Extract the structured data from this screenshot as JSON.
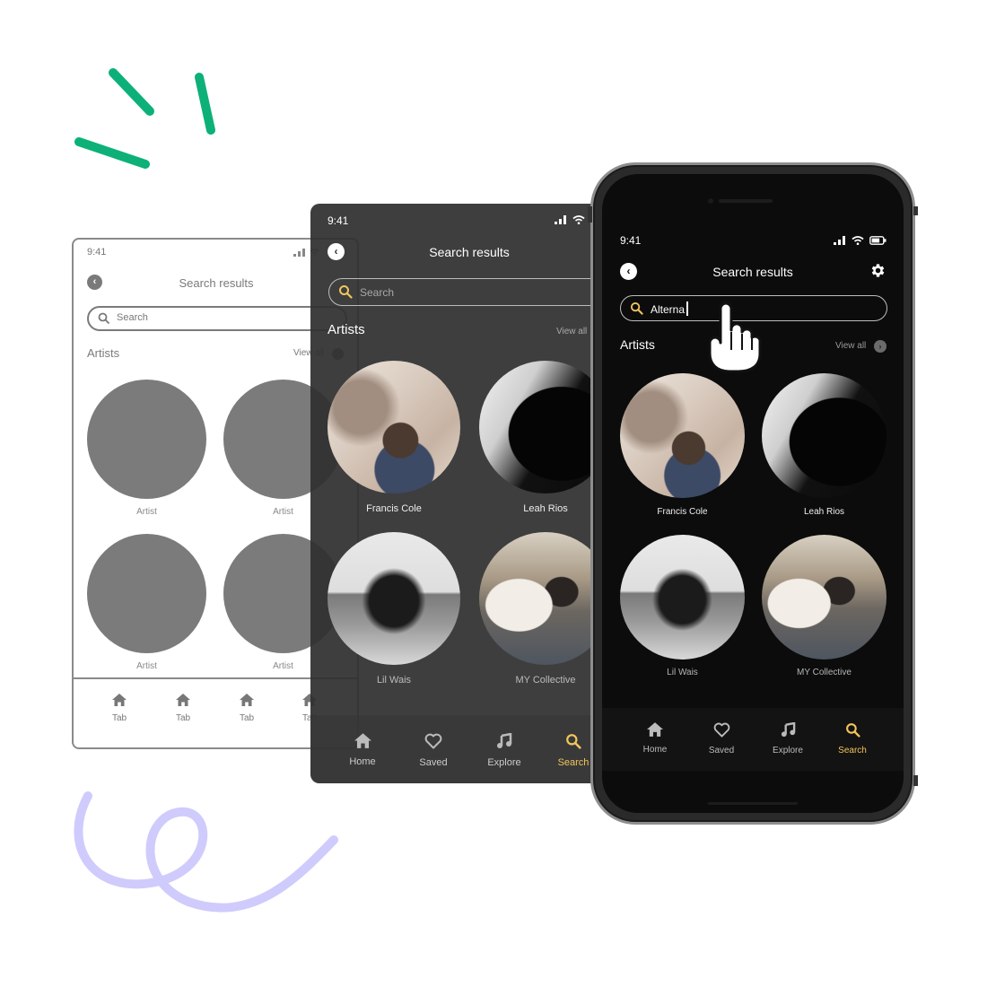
{
  "colors": {
    "accent": "#f2c55c",
    "green_deco": "#0db177",
    "lavender_deco": "#cfcbfc",
    "wireframe_gray": "#7b7b7b",
    "dark_card": "#2f2f2f",
    "phone_screen": "#0c0c0c"
  },
  "wireframe": {
    "status_time": "9:41",
    "back_icon": "chevron-left-icon",
    "title": "Search results",
    "search_placeholder": "Search",
    "section_title": "Artists",
    "view_all": "View all",
    "artists": [
      "Artist",
      "Artist",
      "Artist",
      "Artist"
    ],
    "tabs": [
      {
        "label": "Tab",
        "icon": "home-icon"
      },
      {
        "label": "Tab",
        "icon": "home-icon"
      },
      {
        "label": "Tab",
        "icon": "home-icon"
      },
      {
        "label": "Tab",
        "icon": "home-icon"
      }
    ]
  },
  "mid": {
    "status_time": "9:41",
    "title": "Search results",
    "search_placeholder": "Search",
    "section_title": "Artists",
    "view_all": "View all",
    "artists": [
      "Francis Cole",
      "Leah Rios",
      "Lil Wais",
      "MY Collective"
    ],
    "tabs": [
      {
        "label": "Home",
        "icon": "home-icon"
      },
      {
        "label": "Saved",
        "icon": "heart-icon"
      },
      {
        "label": "Explore",
        "icon": "music-note-icon"
      },
      {
        "label": "Search",
        "icon": "search-icon",
        "active": true
      }
    ]
  },
  "phone": {
    "status_time": "9:41",
    "title": "Search results",
    "settings_icon": "gear-icon",
    "search_value": "Alterna",
    "section_title": "Artists",
    "view_all": "View all",
    "artists": [
      "Francis Cole",
      "Leah Rios",
      "Lil Wais",
      "MY Collective"
    ],
    "tabs": [
      {
        "label": "Home",
        "icon": "home-icon"
      },
      {
        "label": "Saved",
        "icon": "heart-icon"
      },
      {
        "label": "Explore",
        "icon": "music-note-icon"
      },
      {
        "label": "Search",
        "icon": "search-icon",
        "active": true
      }
    ]
  },
  "cursor": "pointer-hand-icon"
}
